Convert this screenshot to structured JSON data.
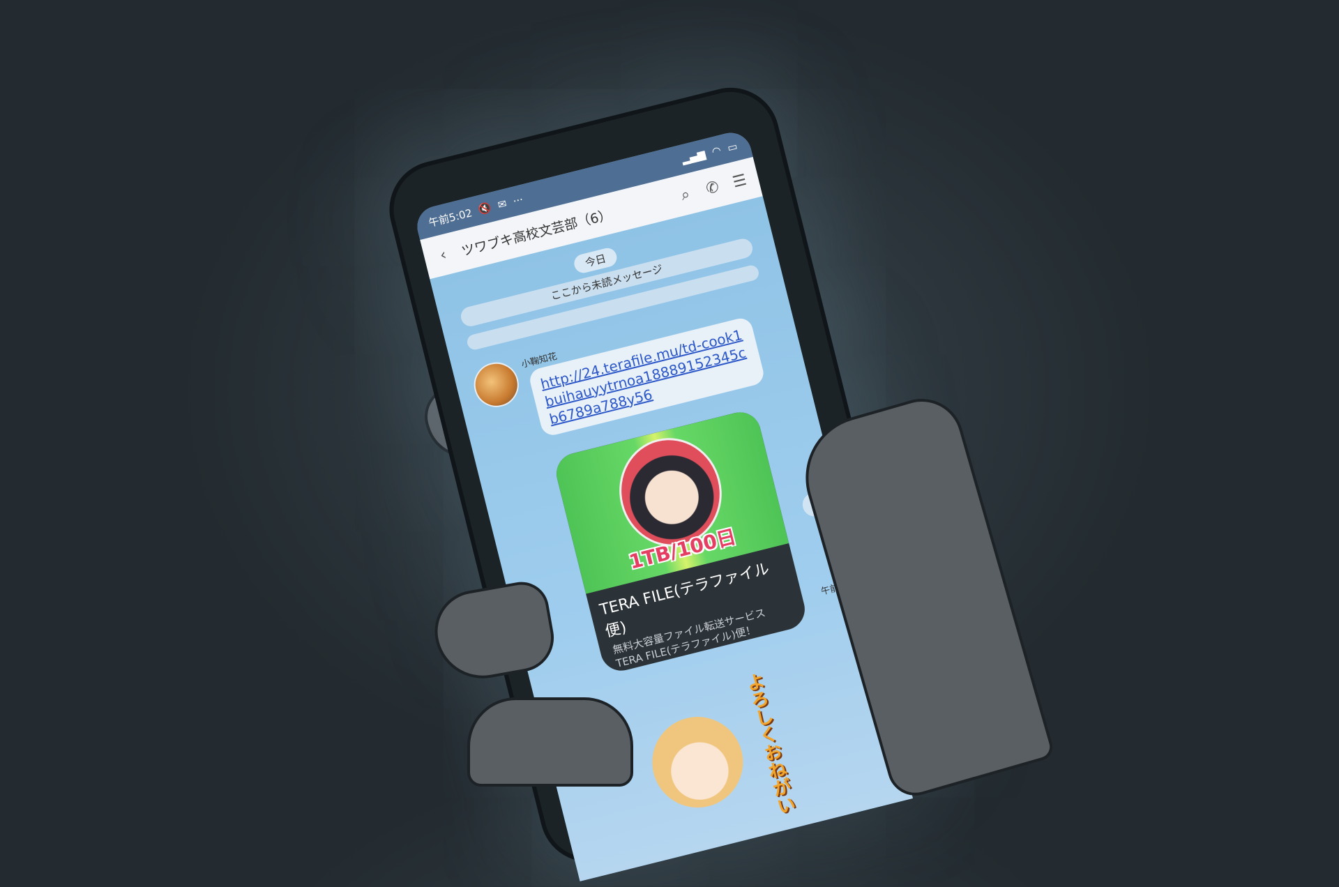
{
  "status_bar": {
    "time": "午前5:02",
    "icons": [
      "mute-icon",
      "mail-icon",
      "more-icon",
      "signal-icon",
      "wifi-icon",
      "battery-icon"
    ]
  },
  "header": {
    "title": "ツワブキ高校文芸部（6）",
    "back_icon": "chevron-left-icon",
    "search_icon": "search-icon",
    "call_icon": "phone-icon",
    "menu_icon": "menu-icon"
  },
  "chat": {
    "date_label": "今日",
    "unread_label": "ここから未読メッセージ",
    "message": {
      "sender": "小鞠知花",
      "link": "http://24.terafile.mu/td-cook1buihauyytrnoa18889152345cb6789a788y56",
      "time": "午前3:01"
    },
    "preview": {
      "badge": "1TB/100日",
      "title": "TERA FILE(テラファイル便)",
      "desc_line1": "無料大容量ファイル転送サービス",
      "desc_line2": "TERA FILE(テラファイル)便！"
    },
    "sticker_text": "よろしくおねがい"
  },
  "colors": {
    "status_bar": "#4f6e93",
    "header_bg": "#f3f5f8",
    "chat_bg": "#8fc3e6",
    "link": "#2c57c8",
    "badge": "#e53e63",
    "background": "#2c363c"
  }
}
